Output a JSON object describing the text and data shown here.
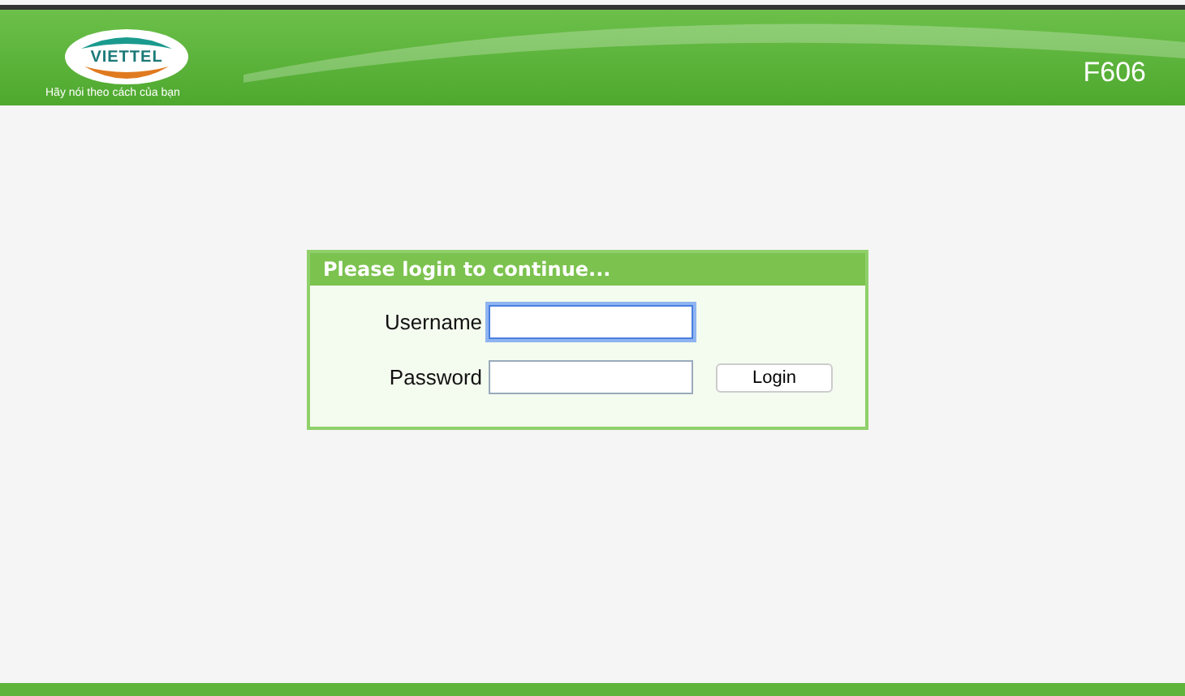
{
  "header": {
    "logo_text": "VIETTEL",
    "slogan": "Hãy nói theo cách của bạn",
    "model": "F606"
  },
  "login": {
    "title": "Please login to continue...",
    "fields": [
      {
        "label": "Username",
        "focused": true
      },
      {
        "label": "Password",
        "focused": false
      }
    ],
    "button": "Login"
  }
}
